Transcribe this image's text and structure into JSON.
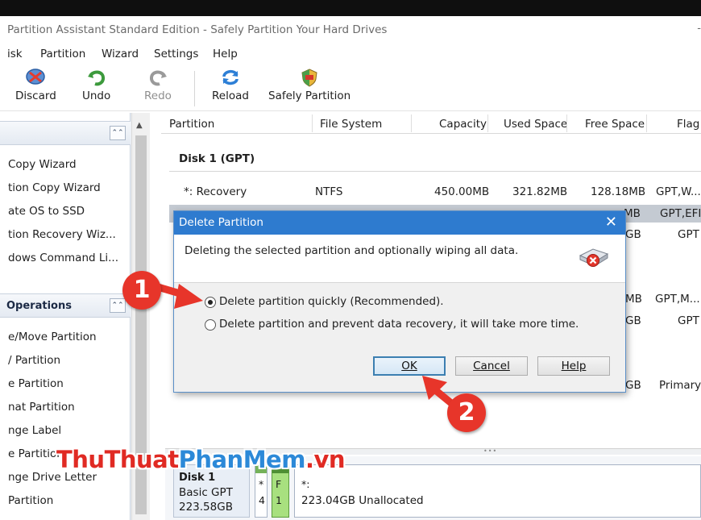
{
  "window": {
    "title": "Partition Assistant Standard Edition - Safely Partition Your Hard Drives",
    "minimize": "-"
  },
  "menu": [
    "isk",
    "Partition",
    "Wizard",
    "Settings",
    "Help"
  ],
  "toolbar": {
    "discard": "Discard",
    "undo": "Undo",
    "redo": "Redo",
    "reload": "Reload",
    "safely_partition": "Safely Partition"
  },
  "sidebar": {
    "wizards_items": [
      "Copy Wizard",
      "tion Copy Wizard",
      "ate OS to SSD",
      "tion Recovery Wiz...",
      "dows Command Li..."
    ],
    "operations_title": "Operations",
    "operations_items": [
      "e/Move Partition",
      "/ Partition",
      "e Partition",
      "nat Partition",
      "nge Label",
      "e Partition",
      "nge Drive Letter",
      "Partition"
    ]
  },
  "table": {
    "columns": [
      "Partition",
      "File System",
      "Capacity",
      "Used Space",
      "Free Space",
      "Flag"
    ],
    "disk_title": "Disk 1 (GPT)",
    "rows": [
      [
        "*: Recovery",
        "NTFS",
        "450.00MB",
        "321.82MB",
        "128.18MB",
        "GPT,W..."
      ],
      [
        "",
        "",
        "",
        "",
        "MB",
        "GPT,EFI"
      ],
      [
        "",
        "",
        "",
        "",
        "GB",
        "GPT"
      ],
      [
        "",
        "",
        "",
        "",
        "MB",
        "GPT,M..."
      ],
      [
        "",
        "",
        "",
        "",
        "GB",
        "GPT"
      ],
      [
        "",
        "",
        "",
        "",
        "GB",
        "Primary"
      ]
    ]
  },
  "diskmap": {
    "disk_name": "Disk 1",
    "disk_type": "Basic GPT",
    "disk_size": "223.58GB",
    "p1_a": "*",
    "p1_b": "4",
    "p2_a": "F",
    "p2_b": "1",
    "unalloc_a": "*:",
    "unalloc_b": "223.04GB Unallocated"
  },
  "dialog": {
    "title": "Delete Partition",
    "message": "Deleting the selected partition and optionally wiping all data.",
    "option1": "Delete partition quickly (Recommended).",
    "option2": "Delete partition and prevent data recovery, it will take more time.",
    "ok": "OK",
    "cancel": "Cancel",
    "help": "Help"
  },
  "annotations": {
    "step1": "1",
    "step2": "2"
  },
  "watermark": {
    "part1": "ThuThuat",
    "part2": "PhanMem",
    "part3": ".vn"
  },
  "colors": {
    "dialog_title": "#2e7bcf",
    "badge": "#e7352a",
    "watermark_red": "#e02a23",
    "watermark_blue": "#2c89d8"
  }
}
